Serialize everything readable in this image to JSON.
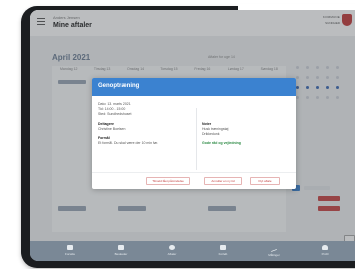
{
  "header": {
    "user_name": "Anders Jensen",
    "page_title": "Mine aftaler",
    "logo_text": "KOMMUNE",
    "logo_sub": "SUNDHED"
  },
  "calendar": {
    "month": "April 2021",
    "week_info": "Aftaler for uge 14",
    "days": [
      "Mandag 12",
      "Tirsdag 13",
      "Onsdag 14",
      "Torsdag 15",
      "Fredag 16",
      "Lørdag 17",
      "Søndag 18"
    ]
  },
  "modal": {
    "title": "Genoptræning",
    "date": "Dato: 13. marts 2021",
    "time": "Tid: 14:00 - 15:00",
    "place": "Sted: Sundhedshuset",
    "participants_label": "Deltagere",
    "participant_name": "Christine Boelsen",
    "purpose_label": "Formål",
    "purpose_text": "Et formål. Du skal være der 10 min før.",
    "more_label": "Noter",
    "more_line1": "Husk træningstøj",
    "more_line2": "Drikkedunk",
    "advice_link": "Gode råd og vejledning",
    "buttons": {
      "find_time": "Tilmeld fået påmindelse",
      "cancel": "Annuller en ny tid",
      "accept": "Flyt aftale"
    }
  },
  "tabbar": {
    "items": [
      {
        "label": "Forside",
        "icon": "home-icon"
      },
      {
        "label": "Beskeder",
        "icon": "envelope-icon"
      },
      {
        "label": "Aftaler",
        "icon": "calendar-icon"
      },
      {
        "label": "Forløb",
        "icon": "chat-icon"
      },
      {
        "label": "Målinger",
        "icon": "chart-icon"
      },
      {
        "label": "Profil",
        "icon": "person-icon"
      }
    ]
  },
  "colors": {
    "accent": "#3b82d0",
    "brand_red": "#c23b3b",
    "success": "#2c8a44",
    "tabbar": "#7a8896"
  }
}
